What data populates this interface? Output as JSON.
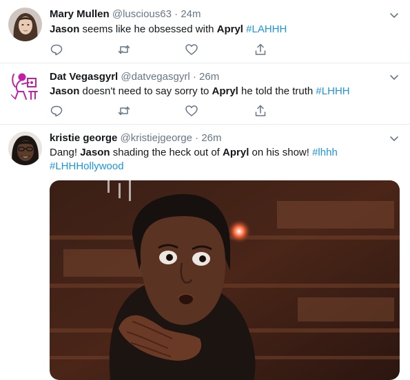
{
  "tweets": [
    {
      "name": "Mary Mullen",
      "handle": "@luscious63",
      "sep": " · ",
      "time": "24m",
      "text": [
        {
          "t": "Jason",
          "s": "bold"
        },
        {
          "t": " seems like he obsessed with ",
          "s": "plain"
        },
        {
          "t": "Apryl",
          "s": "bold"
        },
        {
          "t": " ",
          "s": "plain"
        },
        {
          "t": "#LAHHH",
          "s": "tag"
        }
      ]
    },
    {
      "name": "Dat Vegasgyrl",
      "handle": "@datvegasgyrl",
      "sep": " · ",
      "time": "26m",
      "text": [
        {
          "t": "Jason",
          "s": "bold"
        },
        {
          "t": " doesn't need to say sorry to ",
          "s": "plain"
        },
        {
          "t": "Apryl",
          "s": "bold"
        },
        {
          "t": " he told the truth ",
          "s": "plain"
        },
        {
          "t": "#LHHH",
          "s": "tag"
        }
      ]
    },
    {
      "name": "kristie george",
      "handle": "@kristiejgeorge",
      "sep": " · ",
      "time": "26m",
      "text": [
        {
          "t": "Dang! ",
          "s": "plain"
        },
        {
          "t": "Jason",
          "s": "bold"
        },
        {
          "t": " shading the heck out of ",
          "s": "plain"
        },
        {
          "t": "Apryl",
          "s": "bold"
        },
        {
          "t": " on his show! ",
          "s": "plain"
        },
        {
          "t": "#lhhh",
          "s": "tag"
        },
        {
          "t": "\n",
          "s": "br"
        },
        {
          "t": "#LHHHollywood",
          "s": "tag"
        }
      ]
    }
  ],
  "icons": [
    "reply-icon",
    "retweet-icon",
    "like-icon",
    "share-icon",
    "chevron-down-icon"
  ],
  "colors": {
    "link": "#1b95e0",
    "secondary": "#657786",
    "divider": "#e6ecf0",
    "text": "#14171a"
  }
}
